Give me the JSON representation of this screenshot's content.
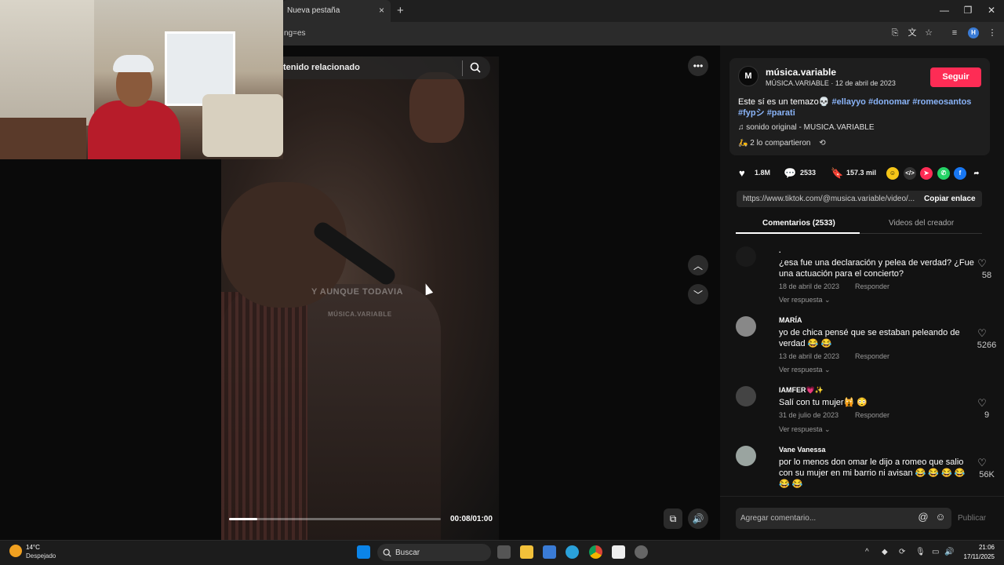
{
  "browser": {
    "tab_title": "Nueva pestaña",
    "tab_close": "×",
    "new_tab": "+",
    "url": "ng=es",
    "profile_initial": "H"
  },
  "video": {
    "search_text": "tenido relacionado",
    "caption": "Y AUNQUE TODAVIA",
    "watermark": "MÚSICA.VARIABLE",
    "time": "00:08/01:00",
    "progress_fraction": 0.133
  },
  "post": {
    "author": "música.variable",
    "author_sub": "MÚSICA.VARIABLE · 12 de abril de 2023",
    "follow_label": "Seguir",
    "desc_text": "Este sí es un temazo💀",
    "tags": [
      "#ellayyo",
      "#donomar",
      "#romeosantos",
      "#fypシ",
      "#parati"
    ],
    "music": "♫  sonido original - MUSICA.VARIABLE",
    "shared": "2 lo compartieron",
    "likes": "1.8M",
    "comments": "2533",
    "saves": "157.3 mil",
    "link_url": "https://www.tiktok.com/@musica.variable/video/...",
    "copy_label": "Copiar enlace"
  },
  "tabs": {
    "comments": "Comentarios (2533)",
    "videos": "Videos del creador"
  },
  "comments": [
    {
      "name": ".",
      "text": "¿esa fue una declaración y pelea de verdad? ¿Fue una actuación para el concierto?",
      "date": "18 de abril de 2023",
      "reply": "Responder",
      "more": "Ver respuesta ⌄",
      "likes": "58"
    },
    {
      "name": "MARÍA",
      "text": "yo de chica pensé que se estaban peleando de verdad 😂 😂",
      "date": "13 de abril de 2023",
      "reply": "Responder",
      "more": "Ver respuesta ⌄",
      "likes": "5266"
    },
    {
      "name": "IAMFER💗✨",
      "text": "Salí con tu mujer🙀 😳",
      "date": "31 de julio de 2023",
      "reply": "Responder",
      "more": "Ver respuesta ⌄",
      "likes": "9"
    },
    {
      "name": "Vane Vanessa",
      "text": "por lo menos don omar le dijo a romeo que salio con su mujer en mi barrio ni avisan 😂 😂 😂 😂 😂 😂",
      "likes": "56K"
    }
  ],
  "comment_input": {
    "placeholder": "Agregar comentario...",
    "publish": "Publicar"
  },
  "taskbar": {
    "temp": "14°C",
    "weather": "Despejado",
    "search": "Buscar",
    "time": "21:06",
    "date": "17/11/2025"
  },
  "colors": {
    "accent": "#fe2c55",
    "tag": "#8ab4f8"
  }
}
